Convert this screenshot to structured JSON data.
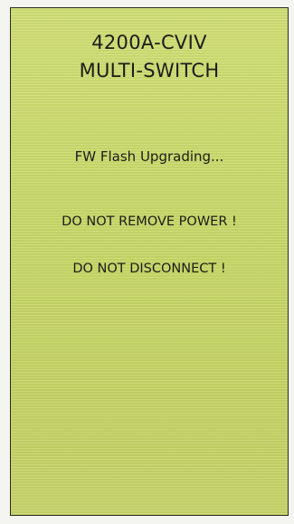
{
  "device": {
    "model": "4200A-CVIV",
    "name": "MULTI-SWITCH"
  },
  "status": {
    "message": "FW Flash Upgrading..."
  },
  "warnings": [
    "DO NOT REMOVE POWER !",
    "DO NOT DISCONNECT !"
  ],
  "colors": {
    "screen_background": "#cddc72",
    "text": "#1c1d18"
  }
}
